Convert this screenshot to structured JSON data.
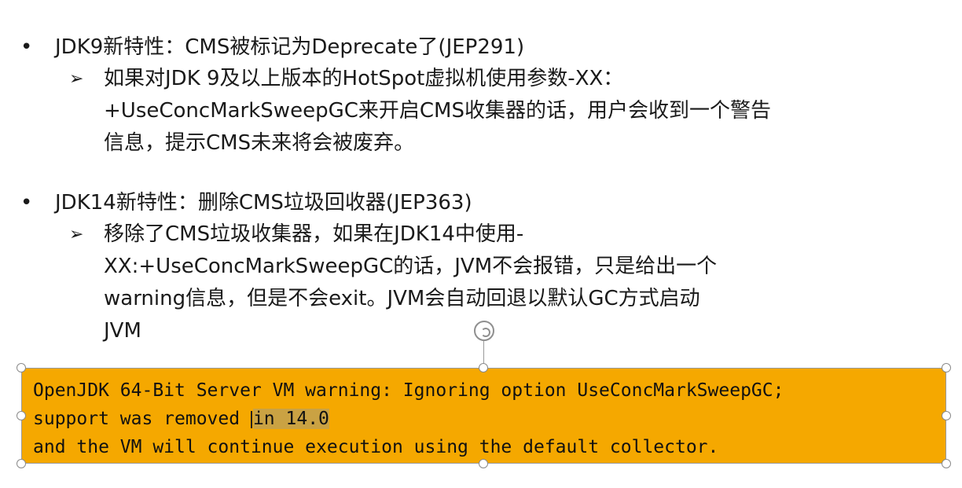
{
  "bullet1": {
    "title": "JDK9新特性：CMS被标记为Deprecate了(JEP291)",
    "sub_lines": [
      "如果对JDK 9及以上版本的HotSpot虚拟机使用参数-XX：",
      "+UseConcMarkSweepGC来开启CMS收集器的话，用户会收到一个警告",
      "信息，提示CMS未来将会被废弃。"
    ]
  },
  "bullet2": {
    "title": "JDK14新特性：删除CMS垃圾回收器(JEP363)",
    "sub_lines": [
      "移除了CMS垃圾收集器，如果在JDK14中使用-",
      "XX:+UseConcMarkSweepGC的话，JVM不会报错，只是给出一个",
      "warning信息，但是不会exit。JVM会自动回退以默认GC方式启动",
      "JVM"
    ]
  },
  "warning_box": {
    "line1": "OpenJDK 64-Bit Server VM warning: Ignoring option UseConcMarkSweepGC;",
    "line2_before": "support was removed ",
    "line2_selected": "in 14.0",
    "line3": "and the VM will continue execution using the default collector."
  },
  "icons": {
    "bullet": "•",
    "arrow": "➢"
  },
  "colors": {
    "box_fill": "#f5a800",
    "selection": "#caa243",
    "text": "#1a1a1a"
  }
}
